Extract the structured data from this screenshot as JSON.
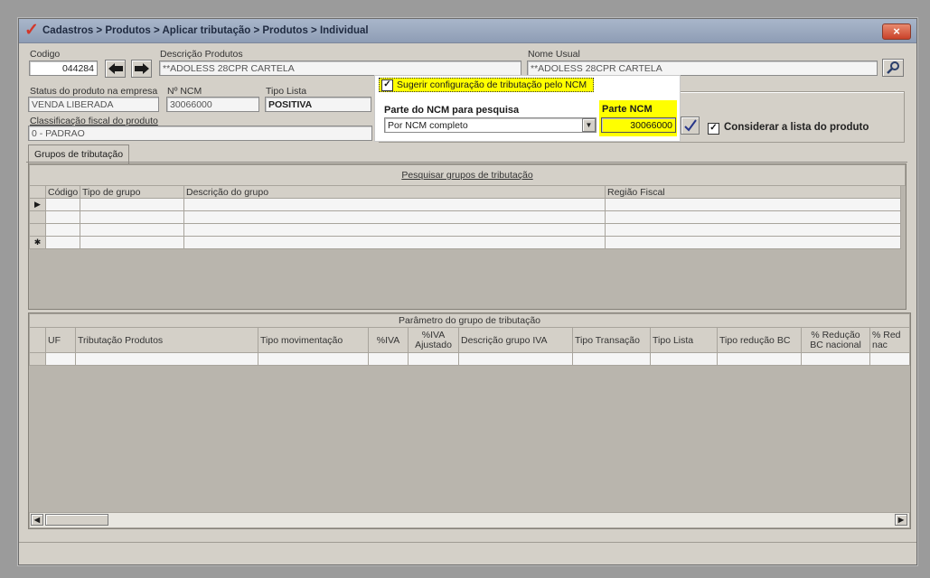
{
  "window": {
    "title": "Cadastros > Produtos > Aplicar tributação > Produtos > Individual",
    "close_label": "×"
  },
  "product": {
    "codigo_label": "Codigo",
    "codigo_value": "044284",
    "descricao_label": "Descrição Produtos",
    "descricao_value": "**ADOLESS 28CPR CARTELA",
    "nome_usual_label": "Nome Usual",
    "nome_usual_value": "**ADOLESS 28CPR CARTELA",
    "status_label": "Status do produto na empresa",
    "status_value": "VENDA LIBERADA",
    "ncm_label": "Nº NCM",
    "ncm_value": "30066000",
    "tipo_lista_label": "Tipo Lista",
    "tipo_lista_value": "POSITIVA",
    "classificacao_label": "Classificação fiscal do produto",
    "classificacao_value": "0 - PADRAO"
  },
  "popup": {
    "sugerir_label": "Sugerir configuração de tributação pelo NCM",
    "parte_pesquisa_label": "Parte do NCM para pesquisa",
    "parte_pesquisa_value": "Por NCM completo",
    "parte_ncm_label": "Parte NCM",
    "parte_ncm_value": "30066000"
  },
  "considerar_label": "Considerar a lista do produto",
  "tabs": [
    {
      "label": "Grupos de tributação"
    }
  ],
  "groups_grid": {
    "title": "Pesquisar grupos de tributação",
    "columns": [
      "Código",
      "Tipo de grupo",
      "Descrição do grupo",
      "Região Fiscal"
    ]
  },
  "params_grid": {
    "title": "Parâmetro do grupo de tributação",
    "columns": [
      "UF",
      "Tributação Produtos",
      "Tipo movimentação",
      "%IVA",
      "%IVA Ajustado",
      "Descrição grupo IVA",
      "Tipo Transação",
      "Tipo Lista",
      "Tipo redução BC",
      "% Redução BC nacional",
      "% Red nac"
    ]
  },
  "icons": {
    "app": "app-logo-icon",
    "prev": "arrow-left-icon",
    "next": "arrow-right-icon",
    "search": "magnifier-icon",
    "confirm": "checkmark-icon"
  },
  "colors": {
    "highlight": "#ffff00",
    "title_bar": "#97a5bd"
  }
}
